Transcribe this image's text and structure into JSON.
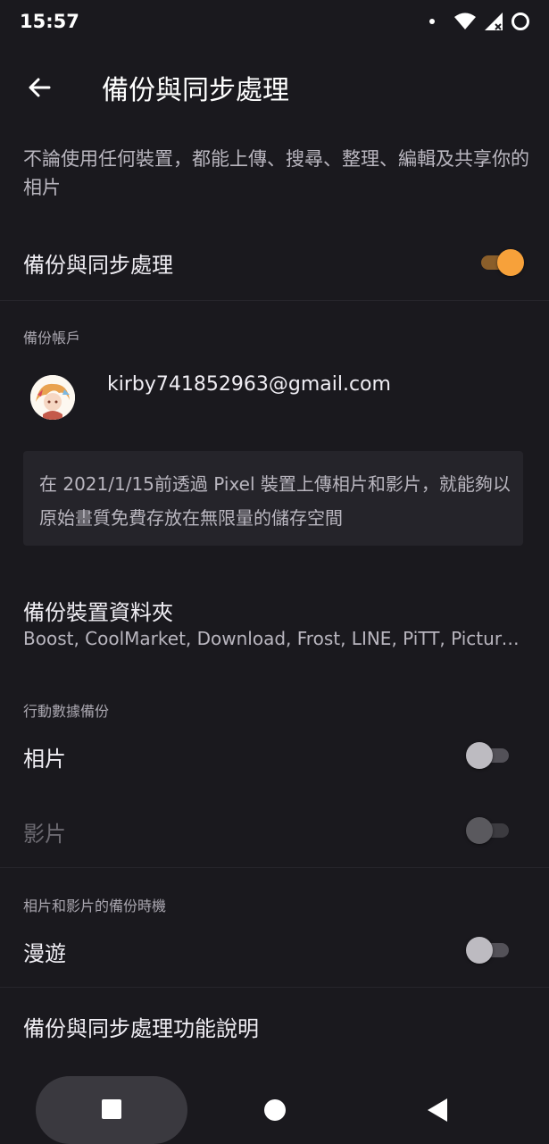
{
  "status_bar": {
    "time": "15:57",
    "icons": [
      "notification-dot-icon",
      "wifi-icon",
      "signal-icon",
      "battery-ring-icon"
    ]
  },
  "app_bar": {
    "title": "備份與同步處理",
    "back_icon": "arrow-back-icon"
  },
  "description": "不論使用任何裝置，都能上傳、搜尋、整理、編輯及共享你的相片",
  "backup_sync": {
    "label": "備份與同步處理",
    "enabled": true
  },
  "account_section": {
    "label": "備份帳戶",
    "email": "kirby741852963@gmail.com"
  },
  "info_text": "在 2021/1/15前透過 Pixel 裝置上傳相片和影片，就能夠以原始畫質免費存放在無限量的儲存空間",
  "device_folders": {
    "title": "備份裝置資料夾",
    "subtitle": "Boost, CoolMarket, Download, Frost, LINE, PiTT, Picture…"
  },
  "mobile_data_section": {
    "label": "行動數據備份",
    "photos": {
      "label": "相片",
      "enabled": false
    },
    "videos": {
      "label": "影片",
      "enabled": false,
      "disabled": true
    }
  },
  "timing_section": {
    "label": "相片和影片的備份時機",
    "roaming": {
      "label": "漫遊",
      "enabled": false
    }
  },
  "help": {
    "label": "備份與同步處理功能說明"
  },
  "colors": {
    "accent": "#f7a13a",
    "background": "#1a191e"
  }
}
